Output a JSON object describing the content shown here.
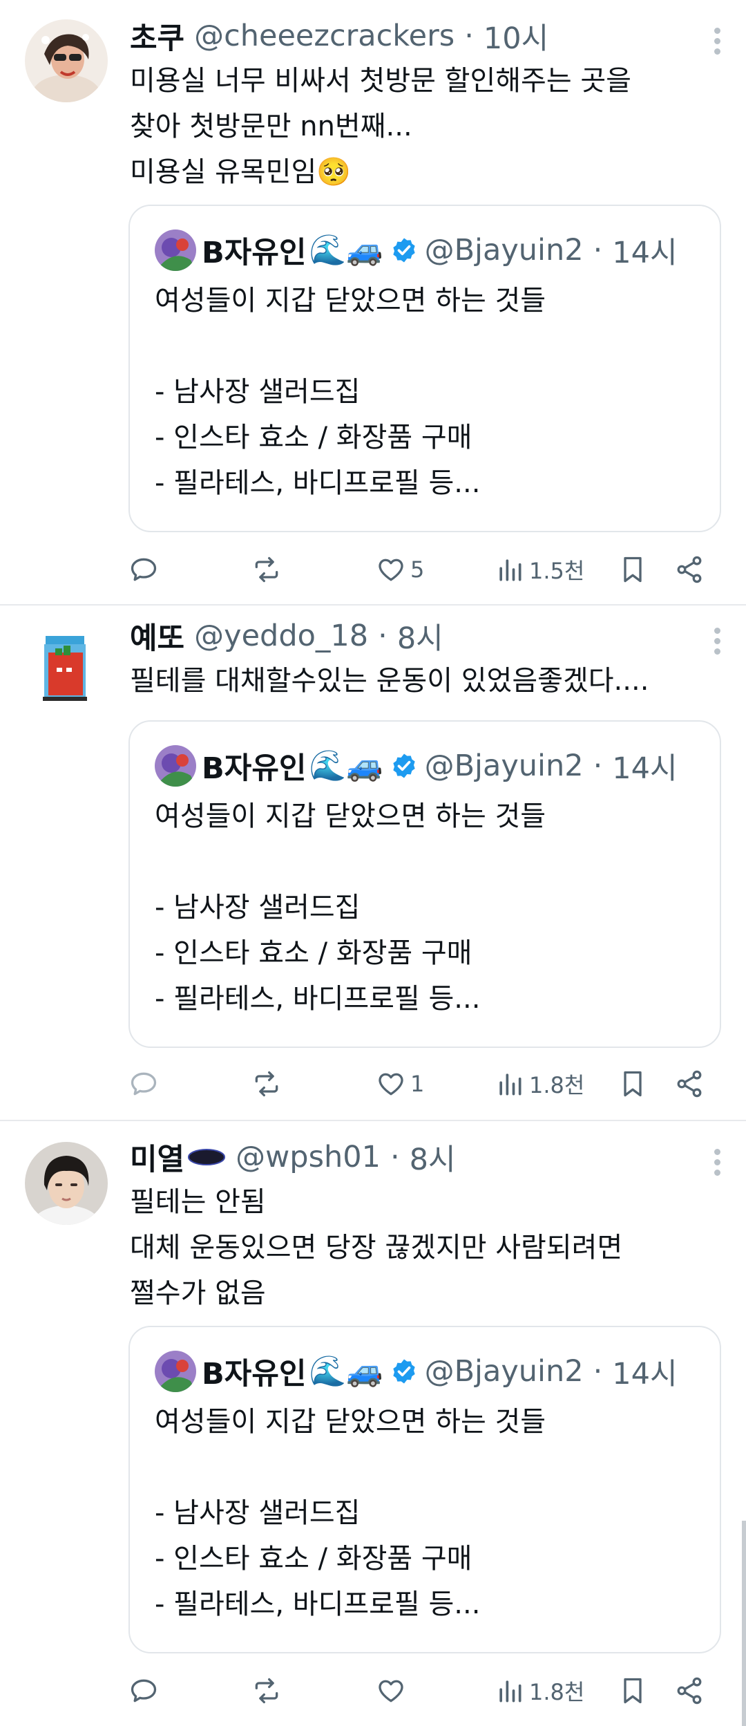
{
  "tweets": [
    {
      "display_name": "초쿠",
      "handle": "@cheeezcrackers",
      "time": "10시",
      "body_lines": [
        "미용실 너무 비싸서 첫방문 할인해주는 곳을",
        "찾아 첫방문만 nn번째...",
        "미용실 유목민임🥺"
      ],
      "quote": {
        "display_name": "B자유인",
        "emojis": "🌊🚙",
        "handle": "@Bjayuin2",
        "time": "14시",
        "lines": [
          "여성들이 지갑 닫았으면 하는 것들",
          "",
          "- 남사장 샐러드집",
          "- 인스타 효소 / 화장품 구매",
          "- 필라테스, 바디프로필 등..."
        ]
      },
      "actions": {
        "reply": "",
        "repost": "",
        "like": "5",
        "views": "1.5천"
      }
    },
    {
      "display_name": "예또",
      "handle": "@yeddo_18",
      "time": "8시",
      "body_lines": [
        "필테를 대채할수있는 운동이 있었음좋겠다...."
      ],
      "quote": {
        "display_name": "B자유인",
        "emojis": "🌊🚙",
        "handle": "@Bjayuin2",
        "time": "14시",
        "lines": [
          "여성들이 지갑 닫았으면 하는 것들",
          "",
          "- 남사장 샐러드집",
          "- 인스타 효소 / 화장품 구매",
          "- 필라테스, 바디프로필 등..."
        ]
      },
      "actions": {
        "reply": "",
        "repost": "",
        "like": "1",
        "views": "1.8천"
      }
    },
    {
      "display_name": "미열",
      "handle": "@wpsh01",
      "time": "8시",
      "body_lines": [
        "필테는 안됨",
        "대체 운동있으면 당장 끊겠지만 사람되려면",
        "쩔수가 없음"
      ],
      "quote": {
        "display_name": "B자유인",
        "emojis": "🌊🚙",
        "handle": "@Bjayuin2",
        "time": "14시",
        "lines": [
          "여성들이 지갑 닫았으면 하는 것들",
          "",
          "- 남사장 샐러드집",
          "- 인스타 효소 / 화장품 구매",
          "- 필라테스, 바디프로필 등..."
        ]
      },
      "actions": {
        "reply": "",
        "repost": "",
        "like": "",
        "views": "1.8천"
      }
    }
  ],
  "separator": "·",
  "icons": {
    "reply": "reply-icon",
    "repost": "repost-icon",
    "like": "like-icon",
    "views": "views-icon",
    "bookmark": "bookmark-icon",
    "share": "share-icon",
    "more": "more-icon",
    "verified": "verified-badge-icon"
  },
  "colors": {
    "text": "#0f1419",
    "secondary": "#536471",
    "border": "#e2e6ea",
    "verified": "#1d9bf0"
  }
}
